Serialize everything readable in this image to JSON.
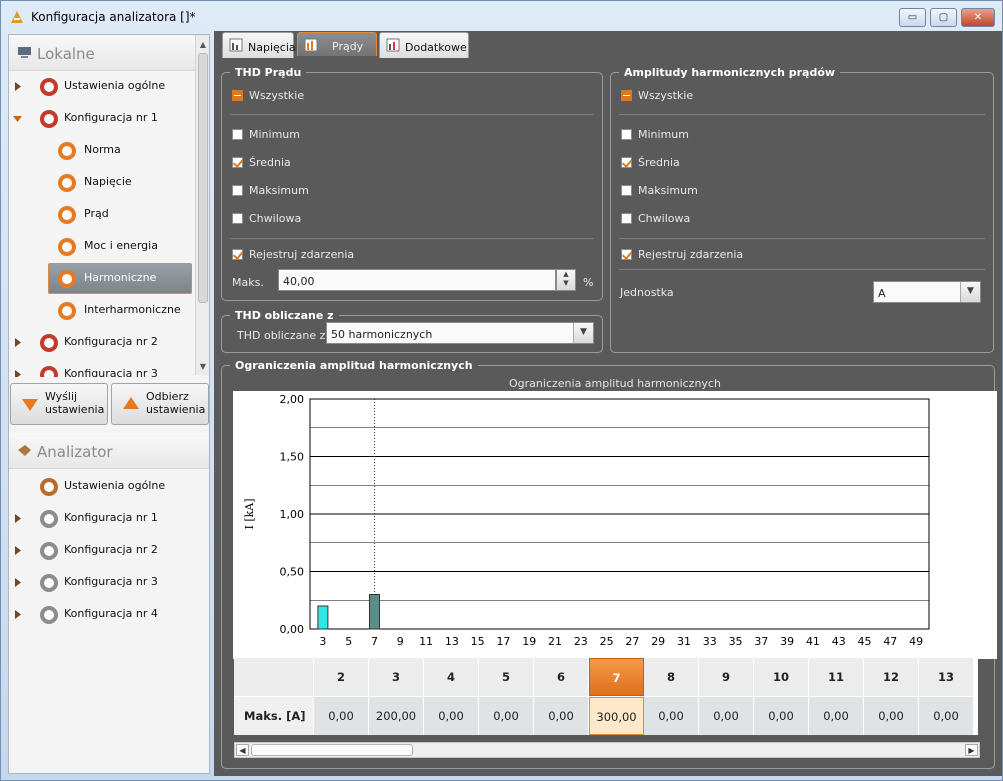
{
  "window": {
    "title": "Konfiguracja analizatora []*",
    "minimize": "▭",
    "maximize": "▢",
    "close": "✕"
  },
  "sidebar": {
    "lokalne": {
      "title": "Lokalne",
      "items": [
        {
          "label": "Ustawienia ogólne",
          "icon": "settings-icon"
        },
        {
          "label": "Konfiguracja nr 1",
          "icon": "config-1-icon",
          "expanded": true
        },
        {
          "label": "Norma",
          "icon": "norm-icon"
        },
        {
          "label": "Napięcie",
          "icon": "voltage-icon"
        },
        {
          "label": "Prąd",
          "icon": "current-icon"
        },
        {
          "label": "Moc i energia",
          "icon": "power-icon"
        },
        {
          "label": "Harmoniczne",
          "icon": "harmonics-icon",
          "selected": true
        },
        {
          "label": "Interharmoniczne",
          "icon": "interharmonics-icon"
        },
        {
          "label": "Konfiguracja nr 2",
          "icon": "config-2-icon"
        },
        {
          "label": "Konfiguracja nr 3",
          "icon": "config-3-icon"
        }
      ]
    },
    "buttons": {
      "send": "Wyślij\nustawienia",
      "receive": "Odbierz\nustawienia"
    },
    "analizator": {
      "title": "Analizator",
      "items": [
        {
          "label": "Ustawienia ogólne",
          "icon": "settings-icon"
        },
        {
          "label": "Konfiguracja nr 1",
          "icon": "config-1-icon"
        },
        {
          "label": "Konfiguracja nr 2",
          "icon": "config-2-icon"
        },
        {
          "label": "Konfiguracja nr 3",
          "icon": "config-3-icon"
        },
        {
          "label": "Konfiguracja nr 4",
          "icon": "config-4-icon"
        }
      ]
    }
  },
  "tabs": [
    {
      "label": "Napięcia",
      "active": false
    },
    {
      "label": "Prądy",
      "active": true
    },
    {
      "label": "Dodatkowe",
      "active": false
    }
  ],
  "thd_pradu": {
    "title": "THD Prądu",
    "all": "Wszystkie",
    "options": [
      {
        "label": "Minimum",
        "checked": false
      },
      {
        "label": "Średnia",
        "checked": true
      },
      {
        "label": "Maksimum",
        "checked": false
      },
      {
        "label": "Chwilowa",
        "checked": false
      }
    ],
    "events": {
      "label": "Rejestruj zdarzenia",
      "checked": true
    },
    "max_label": "Maks.",
    "max_value": "40,00",
    "unit": "%"
  },
  "amplitudy": {
    "title": "Amplitudy harmonicznych prądów",
    "all": "Wszystkie",
    "options": [
      {
        "label": "Minimum",
        "checked": false
      },
      {
        "label": "Średnia",
        "checked": true
      },
      {
        "label": "Maksimum",
        "checked": false
      },
      {
        "label": "Chwilowa",
        "checked": false
      }
    ],
    "events": {
      "label": "Rejestruj zdarzenia",
      "checked": true
    },
    "unit_label": "Jednostka",
    "unit_value": "A"
  },
  "thd_calc": {
    "title": "THD obliczane z",
    "label": "THD obliczane z",
    "value": "50 harmonicznych"
  },
  "limits": {
    "title": "Ograniczenia amplitud harmonicznych"
  },
  "chart_data": {
    "type": "bar",
    "title": "Ograniczenia amplitud harmonicznych",
    "ylabel": "I [kA]",
    "ylim": [
      0,
      2
    ],
    "yticks": [
      "0,00",
      "0,50",
      "1,00",
      "1,50",
      "2,00"
    ],
    "xticks": [
      "3",
      "5",
      "7",
      "9",
      "11",
      "13",
      "15",
      "17",
      "19",
      "21",
      "23",
      "25",
      "27",
      "29",
      "31",
      "33",
      "35",
      "37",
      "39",
      "41",
      "43",
      "45",
      "47",
      "49"
    ],
    "bars": [
      {
        "x": 3,
        "value": 0.2,
        "color": "#2ee8e8"
      },
      {
        "x": 7,
        "value": 0.3,
        "color": "#5a8f88"
      }
    ],
    "cursor_x": 7
  },
  "table": {
    "row_label": "Maks. [A]",
    "selected": 7,
    "columns": [
      {
        "h": "2",
        "v": "0,00"
      },
      {
        "h": "3",
        "v": "200,00"
      },
      {
        "h": "4",
        "v": "0,00"
      },
      {
        "h": "5",
        "v": "0,00"
      },
      {
        "h": "6",
        "v": "0,00"
      },
      {
        "h": "7",
        "v": "300,00"
      },
      {
        "h": "8",
        "v": "0,00"
      },
      {
        "h": "9",
        "v": "0,00"
      },
      {
        "h": "10",
        "v": "0,00"
      },
      {
        "h": "11",
        "v": "0,00"
      },
      {
        "h": "12",
        "v": "0,00"
      },
      {
        "h": "13",
        "v": "0,00"
      }
    ]
  }
}
